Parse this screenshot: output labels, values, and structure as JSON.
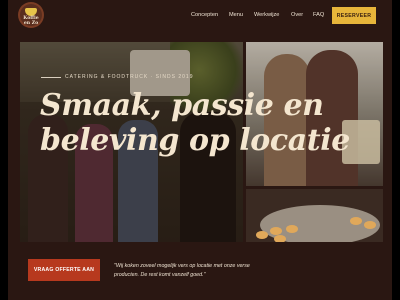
{
  "brand": {
    "logo_text": "Koffie en Zo"
  },
  "nav": {
    "links": [
      {
        "label": "Concepten"
      },
      {
        "label": "Menu"
      },
      {
        "label": "Werkwijze"
      },
      {
        "label": "Over"
      },
      {
        "label": "FAQ"
      }
    ],
    "cta": "RESERVEER"
  },
  "hero": {
    "eyebrow": "CATERING & FOODTRUCK · SINDS 2019",
    "title": "Smaak, passie en beleving op locatie"
  },
  "footer_cta": {
    "button": "VRAAG OFFERTE AAN",
    "quote": "\"Wij koken zoveel mogelijk vers op locatie met onze verse producten. De rest komt vanzelf goed.\""
  },
  "colors": {
    "background": "#2a1712",
    "accent": "#e7b53a",
    "cta": "#b7391e",
    "text": "#f4e6cf"
  }
}
